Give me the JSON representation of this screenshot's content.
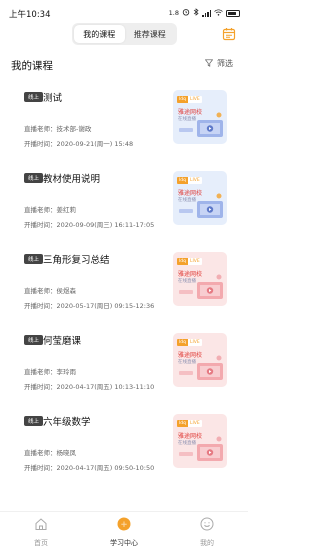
{
  "status_bar": {
    "time": "上午10:34",
    "speed": "1.8",
    "battery_pct": 0.8
  },
  "top_tabs": [
    {
      "label": "我的课程",
      "active": true
    },
    {
      "label": "推荐课程",
      "active": false
    }
  ],
  "header": {
    "title": "我的课程",
    "filter_label": "筛选"
  },
  "colors": {
    "accent": "#f4a12b",
    "badge_bg": "#444444",
    "thumb_blue": "#e6eefb",
    "thumb_pink": "#fbe6e6",
    "brand_red": "#e0403c"
  },
  "course_thumb": {
    "live_a": "ldq",
    "live_b": "LIVE",
    "brand": "雅途网校",
    "sub": "在线直播"
  },
  "courses": [
    {
      "badge": "线上",
      "title": "测试",
      "teacher": "直播老师：技术部-谢政",
      "time": "开播时间：2020-09-21(周一) 15:48",
      "thumb": "blue"
    },
    {
      "badge": "线上",
      "title": "教材使用说明",
      "teacher": "直播老师：姜红莉",
      "time": "开播时间：2020-09-09(周三) 16:11-17:05",
      "thumb": "blue"
    },
    {
      "badge": "线上",
      "title": "三角形复习总结",
      "teacher": "直播老师：侯煜森",
      "time": "开播时间：2020-05-17(周日) 09:15-12:36",
      "thumb": "pink"
    },
    {
      "badge": "线上",
      "title": "何莹磨课",
      "teacher": "直播老师：李玲雨",
      "time": "开播时间：2020-04-17(周五) 10:13-11:10",
      "thumb": "pink"
    },
    {
      "badge": "线上",
      "title": "六年级数学",
      "teacher": "直播老师：杨晓凤",
      "time": "开播时间：2020-04-17(周五) 09:50-10:50",
      "thumb": "pink"
    }
  ],
  "bottom_nav": [
    {
      "label": "首页",
      "icon": "home-icon",
      "active": false
    },
    {
      "label": "学习中心",
      "icon": "study-center-icon",
      "active": true
    },
    {
      "label": "我的",
      "icon": "profile-icon",
      "active": false
    }
  ]
}
